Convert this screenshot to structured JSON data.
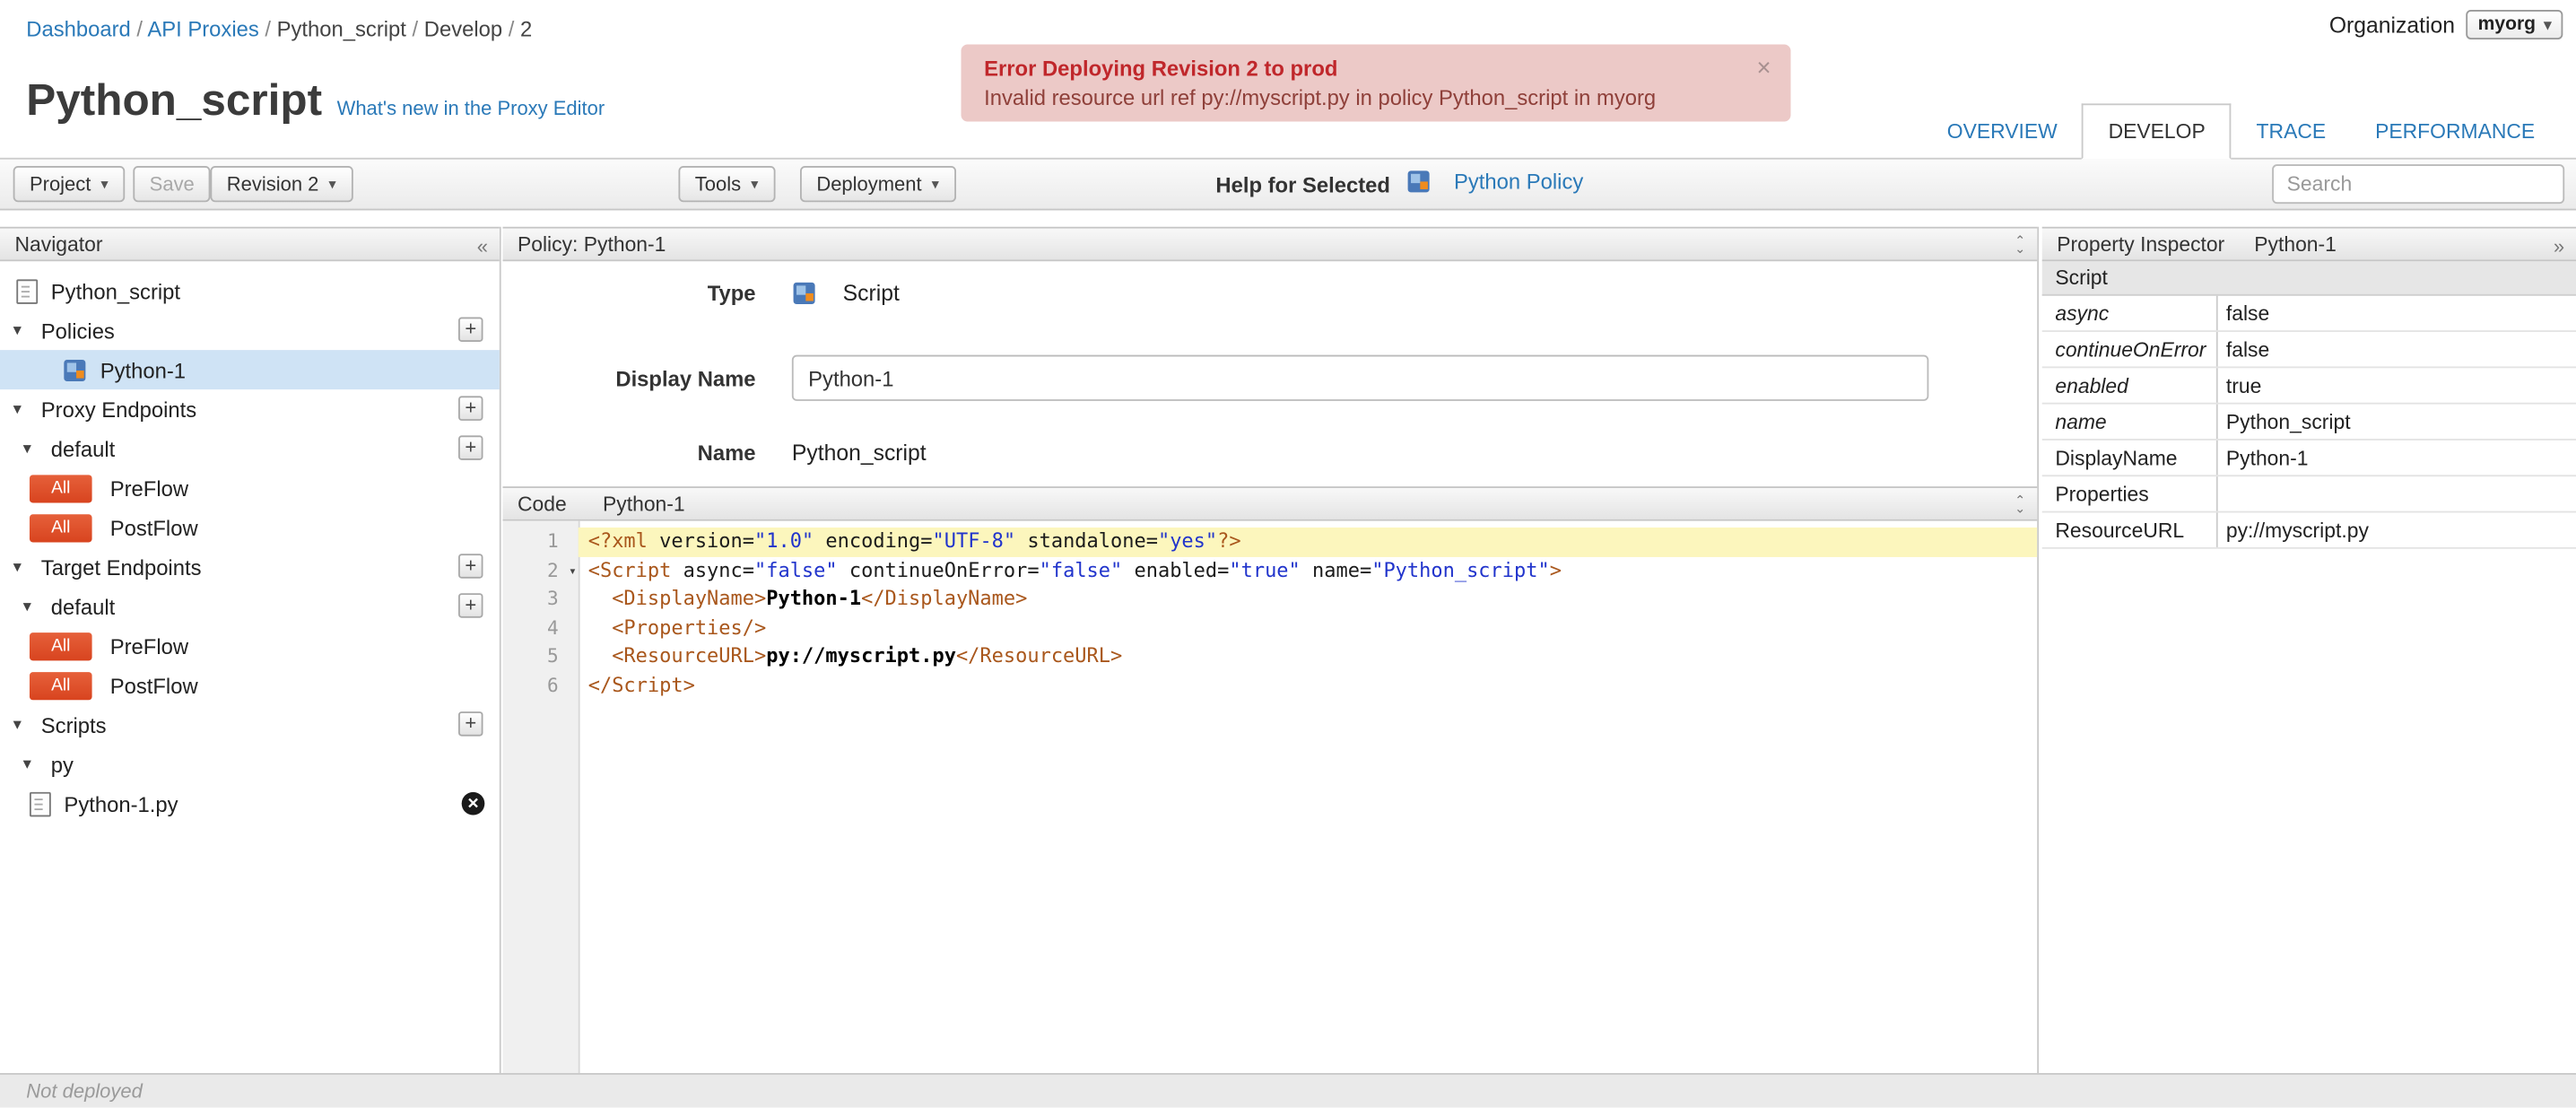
{
  "icons": {
    "collapse_left": "«",
    "collapse_right": "»",
    "caret_down": "▾",
    "close": "×",
    "plus": "+",
    "delete_x": "✕",
    "chevron_up": "⌃",
    "chevron_down": "⌄"
  },
  "breadcrumb": {
    "separator": "/",
    "items": [
      {
        "label": "Dashboard",
        "link": true
      },
      {
        "label": "API Proxies",
        "link": true
      },
      {
        "label": "Python_script",
        "link": false
      },
      {
        "label": "Develop",
        "link": false
      },
      {
        "label": "2",
        "link": false
      }
    ]
  },
  "organization": {
    "label": "Organization",
    "value": "myorg"
  },
  "error_banner": {
    "title": "Error Deploying Revision 2 to prod",
    "message": "Invalid resource url ref py://myscript.py in policy Python_script in myorg"
  },
  "page": {
    "title": "Python_script",
    "whats_new_link": "What's new in the Proxy Editor"
  },
  "tabs": [
    {
      "label": "OVERVIEW",
      "active": false
    },
    {
      "label": "DEVELOP",
      "active": true
    },
    {
      "label": "TRACE",
      "active": false
    },
    {
      "label": "PERFORMANCE",
      "active": false
    }
  ],
  "toolbar": {
    "project": "Project",
    "save": "Save",
    "revision": "Revision 2",
    "tools": "Tools",
    "deployment": "Deployment",
    "help_for_selected": "Help for Selected",
    "policy_link": "Python Policy",
    "search_placeholder": "Search"
  },
  "navigator": {
    "title": "Navigator",
    "rows": [
      {
        "kind": "root-file",
        "label": "Python_script"
      },
      {
        "kind": "section",
        "label": "Policies",
        "add": true
      },
      {
        "kind": "policy",
        "label": "Python-1",
        "selected": true
      },
      {
        "kind": "section",
        "label": "Proxy Endpoints",
        "add": true
      },
      {
        "kind": "subsection",
        "label": "default",
        "add": true
      },
      {
        "kind": "flow",
        "label": "PreFlow",
        "badge": "All"
      },
      {
        "kind": "flow",
        "label": "PostFlow",
        "badge": "All"
      },
      {
        "kind": "section",
        "label": "Target Endpoints",
        "add": true
      },
      {
        "kind": "subsection",
        "label": "default",
        "add": true
      },
      {
        "kind": "flow",
        "label": "PreFlow",
        "badge": "All"
      },
      {
        "kind": "flow",
        "label": "PostFlow",
        "badge": "All"
      },
      {
        "kind": "section",
        "label": "Scripts",
        "add": true
      },
      {
        "kind": "folder",
        "label": "py"
      },
      {
        "kind": "file",
        "label": "Python-1.py",
        "delete": true
      }
    ]
  },
  "editor": {
    "policy_header": "Policy: Python-1",
    "type_label": "Type",
    "type_value": "Script",
    "display_name_label": "Display Name",
    "display_name_value": "Python-1",
    "name_label": "Name",
    "name_value": "Python_script",
    "code_label": "Code",
    "code_file": "Python-1"
  },
  "code": {
    "lines": [
      {
        "n": 1,
        "highlight": true,
        "tokens": [
          [
            "tag",
            "<?xml"
          ],
          [
            "attr",
            " version="
          ],
          [
            "str",
            "\"1.0\""
          ],
          [
            "attr",
            " encoding="
          ],
          [
            "str",
            "\"UTF-8\""
          ],
          [
            "attr",
            " standalone="
          ],
          [
            "str",
            "\"yes\""
          ],
          [
            "tag",
            "?>"
          ]
        ]
      },
      {
        "n": 2,
        "fold": true,
        "tokens": [
          [
            "tag",
            "<Script"
          ],
          [
            "attr",
            " async="
          ],
          [
            "str",
            "\"false\""
          ],
          [
            "attr",
            " continueOnError="
          ],
          [
            "str",
            "\"false\""
          ],
          [
            "attr",
            " enabled="
          ],
          [
            "str",
            "\"true\""
          ],
          [
            "attr",
            " name="
          ],
          [
            "str",
            "\"Python_script\""
          ],
          [
            "tag",
            ">"
          ]
        ]
      },
      {
        "n": 3,
        "tokens": [
          [
            "plain",
            "  "
          ],
          [
            "tag",
            "<DisplayName>"
          ],
          [
            "text",
            "Python-1"
          ],
          [
            "tag",
            "</DisplayName>"
          ]
        ]
      },
      {
        "n": 4,
        "tokens": [
          [
            "plain",
            "  "
          ],
          [
            "tag",
            "<Properties/>"
          ]
        ]
      },
      {
        "n": 5,
        "tokens": [
          [
            "plain",
            "  "
          ],
          [
            "tag",
            "<ResourceURL>"
          ],
          [
            "text",
            "py://myscript.py"
          ],
          [
            "tag",
            "</ResourceURL>"
          ]
        ]
      },
      {
        "n": 6,
        "tokens": [
          [
            "tag",
            "</Script>"
          ]
        ]
      }
    ]
  },
  "inspector": {
    "title": "Property Inspector",
    "subtitle": "Python-1",
    "section": "Script",
    "rows": [
      {
        "key": "async",
        "value": "false",
        "italic": true
      },
      {
        "key": "continueOnError",
        "value": "false",
        "italic": true
      },
      {
        "key": "enabled",
        "value": "true",
        "italic": true
      },
      {
        "key": "name",
        "value": "Python_script",
        "italic": true
      },
      {
        "key": "DisplayName",
        "value": "Python-1",
        "italic": false
      },
      {
        "key": "Properties",
        "value": "",
        "italic": false
      },
      {
        "key": "ResourceURL",
        "value": "py://myscript.py",
        "italic": false
      }
    ]
  },
  "statusbar": {
    "text": "Not deployed"
  }
}
